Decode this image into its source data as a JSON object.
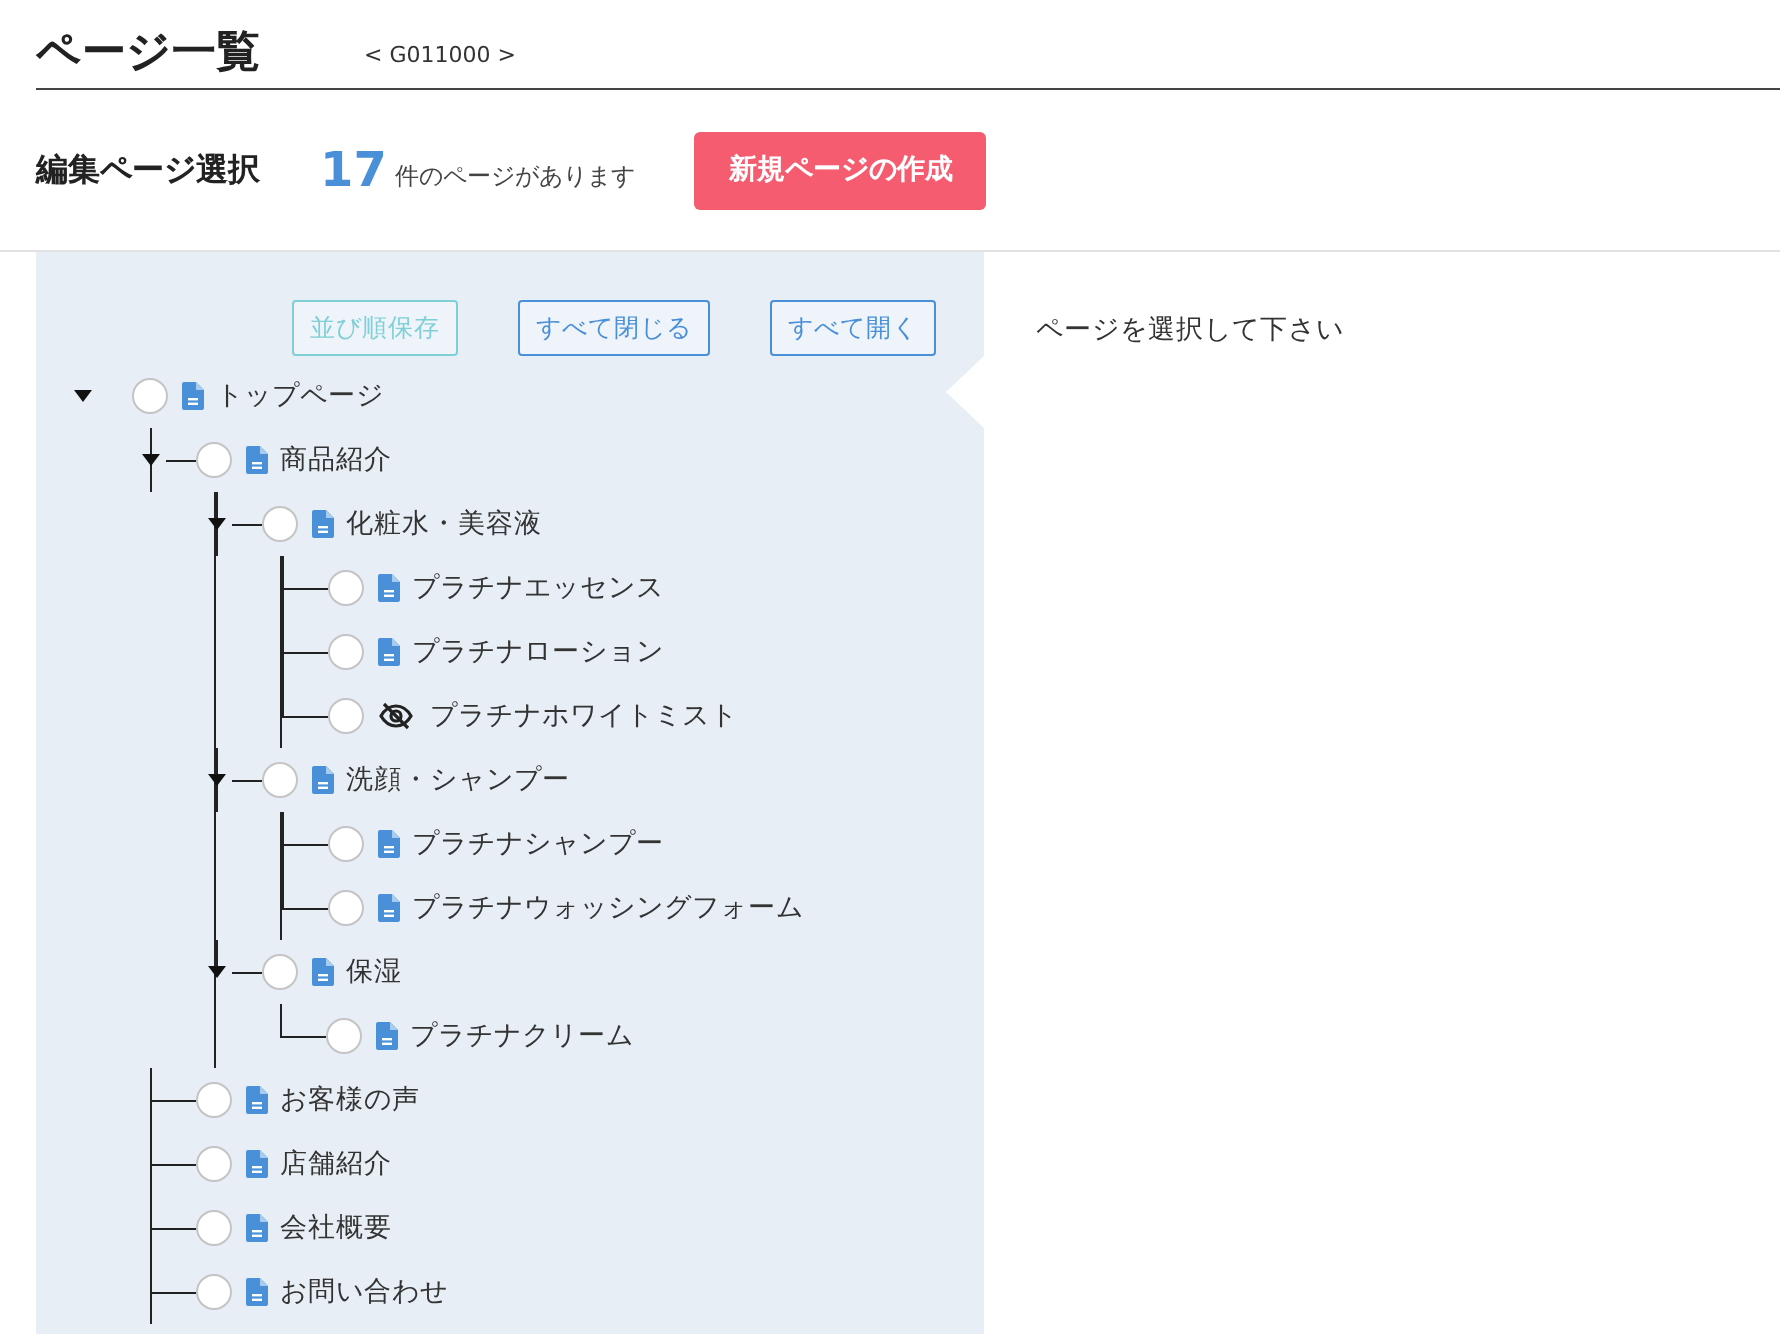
{
  "header": {
    "title": "ページ一覧",
    "code": "< G011000 >"
  },
  "toolbar": {
    "heading": "編集ページ選択",
    "count": "17",
    "count_suffix": "件のページがあります",
    "create_button": "新規ページの作成"
  },
  "tree_buttons": [
    {
      "label": "並び順保存",
      "disabled": true
    },
    {
      "label": "すべて閉じる",
      "disabled": false
    },
    {
      "label": "すべて開く",
      "disabled": false
    }
  ],
  "tree": [
    {
      "label": "トップページ",
      "kind": "page",
      "selected": false,
      "expanded": true,
      "children": [
        {
          "label": "商品紹介",
          "kind": "page",
          "selected": false,
          "expanded": true,
          "children": [
            {
              "label": "化粧水・美容液",
              "kind": "page",
              "selected": false,
              "expanded": true,
              "children": [
                {
                  "label": "プラチナエッセンス",
                  "kind": "page",
                  "selected": false
                },
                {
                  "label": "プラチナローション",
                  "kind": "page",
                  "selected": false
                },
                {
                  "label": "プラチナホワイトミスト",
                  "kind": "hidden",
                  "selected": false
                }
              ]
            },
            {
              "label": "洗顔・シャンプー",
              "kind": "page",
              "selected": false,
              "expanded": true,
              "children": [
                {
                  "label": "プラチナシャンプー",
                  "kind": "page",
                  "selected": false
                },
                {
                  "label": "プラチナウォッシングフォーム",
                  "kind": "page",
                  "selected": false
                }
              ]
            },
            {
              "label": "保湿",
              "kind": "page",
              "selected": false,
              "expanded": true,
              "children": [
                {
                  "label": "プラチナクリーム",
                  "kind": "page",
                  "selected": false
                }
              ]
            }
          ]
        },
        {
          "label": "お客様の声",
          "kind": "page",
          "selected": false
        },
        {
          "label": "店舗紹介",
          "kind": "page",
          "selected": false
        },
        {
          "label": "会社概要",
          "kind": "page",
          "selected": false
        },
        {
          "label": "お問い合わせ",
          "kind": "page",
          "selected": false
        }
      ]
    }
  ],
  "detail": {
    "message": "ページを選択して下さい"
  }
}
